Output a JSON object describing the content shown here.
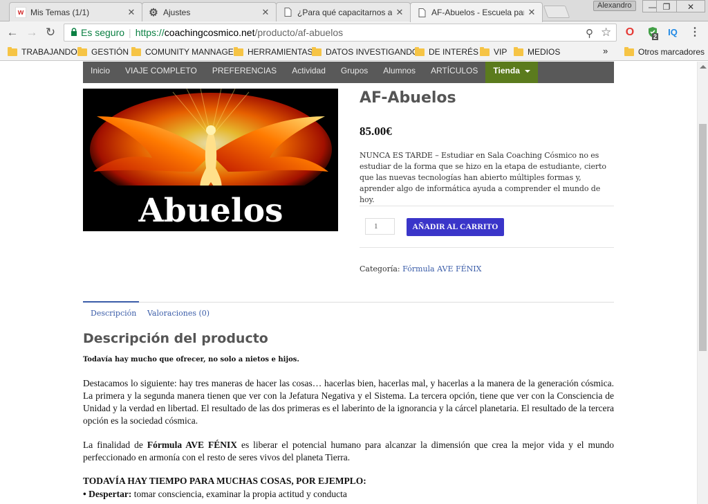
{
  "browser": {
    "tabs": [
      {
        "title": "Mis Temas (1/1)",
        "favicon": "w"
      },
      {
        "title": "Ajustes",
        "favicon": "gear-icon"
      },
      {
        "title": "¿Para qué capacitarnos aq",
        "favicon": "page-icon"
      },
      {
        "title": "AF-Abuelos - Escuela para",
        "favicon": "page-icon"
      }
    ],
    "user": "Alexandro",
    "omnibox": {
      "secure_label": "Es seguro",
      "url_proto": "https://",
      "url_host": "coachingcosmico.net",
      "url_path": "/producto/af-abuelos"
    },
    "extension_badge": "2",
    "extension_iq": "IQ",
    "bookmarks": [
      "TRABAJANDO",
      "GESTIÓN",
      "COMUNITY MANNAGER",
      "HERRAMIENTAS",
      "DATOS INVESTIGANDO",
      "DE INTERÉS",
      "VIP",
      "MEDIOS"
    ],
    "bookmarks_more": "»",
    "other_bookmarks": "Otros marcadores",
    "colors": {
      "secure": "#0b8043",
      "nav_bg": "#595959",
      "shop_bg": "#5b7b1d",
      "button": "#3a35c9",
      "link": "#3a5ca8"
    }
  },
  "site_nav": {
    "items": [
      "Inicio",
      "VIAJE COMPLETO",
      "PREFERENCIAS",
      "Actividad",
      "Grupos",
      "Alumnos",
      "ARTÍCULOS"
    ],
    "shop": "Tienda"
  },
  "product": {
    "image_text": "Abuelos",
    "title": "AF-Abuelos",
    "price": "85.00€",
    "short_description": "NUNCA ES TARDE – Estudiar en Sala Coaching Cósmico no es estudiar de la forma que se hizo en la etapa de estudiante, cierto que las nuevas tecnologías han abierto múltiples formas y, aprender algo de informática ayuda a comprender el mundo de hoy.",
    "quantity": "1",
    "add_to_cart": "AÑADIR AL CARRITO",
    "category_label": "Categoría: ",
    "category_link": "Fórmula AVE FÉNIX"
  },
  "product_tabs": [
    "Descripción",
    "Valoraciones (0)"
  ],
  "description": {
    "heading": "Descripción del producto",
    "intro_bold": "Todavía hay mucho que ofrecer, no solo a nietos e hijos.",
    "para1": "Destacamos lo siguiente: hay tres maneras de hacer las cosas… hacerlas bien, hacerlas mal, y hacerlas a la manera de la generación cósmica. La primera y la segunda manera tienen que ver con la Jefatura Negativa y el Sistema. La tercera opción, tiene que ver con la Consciencia de Unidad y la verdad en libertad. El resultado de las dos primeras es el laberinto de la ignorancia y la cárcel planetaria. El resultado de la tercera opción es la sociedad cósmica.",
    "para2_pre": "La finalidad de ",
    "para2_bold": "Fórmula AVE FÉNIX",
    "para2_post": " es liberar el potencial humano para alcanzar la dimensión que crea la mejor vida y el mundo perfeccionado en armonía con el resto de seres vivos del planeta Tierra.",
    "list_heading": "TODAVÍA HAY TIEMPO PARA MUCHAS COSAS, POR EJEMPLO:",
    "bullet1_bold": "• Despertar:",
    "bullet1_text": " tomar consciencia, examinar la propia actitud y conducta"
  }
}
